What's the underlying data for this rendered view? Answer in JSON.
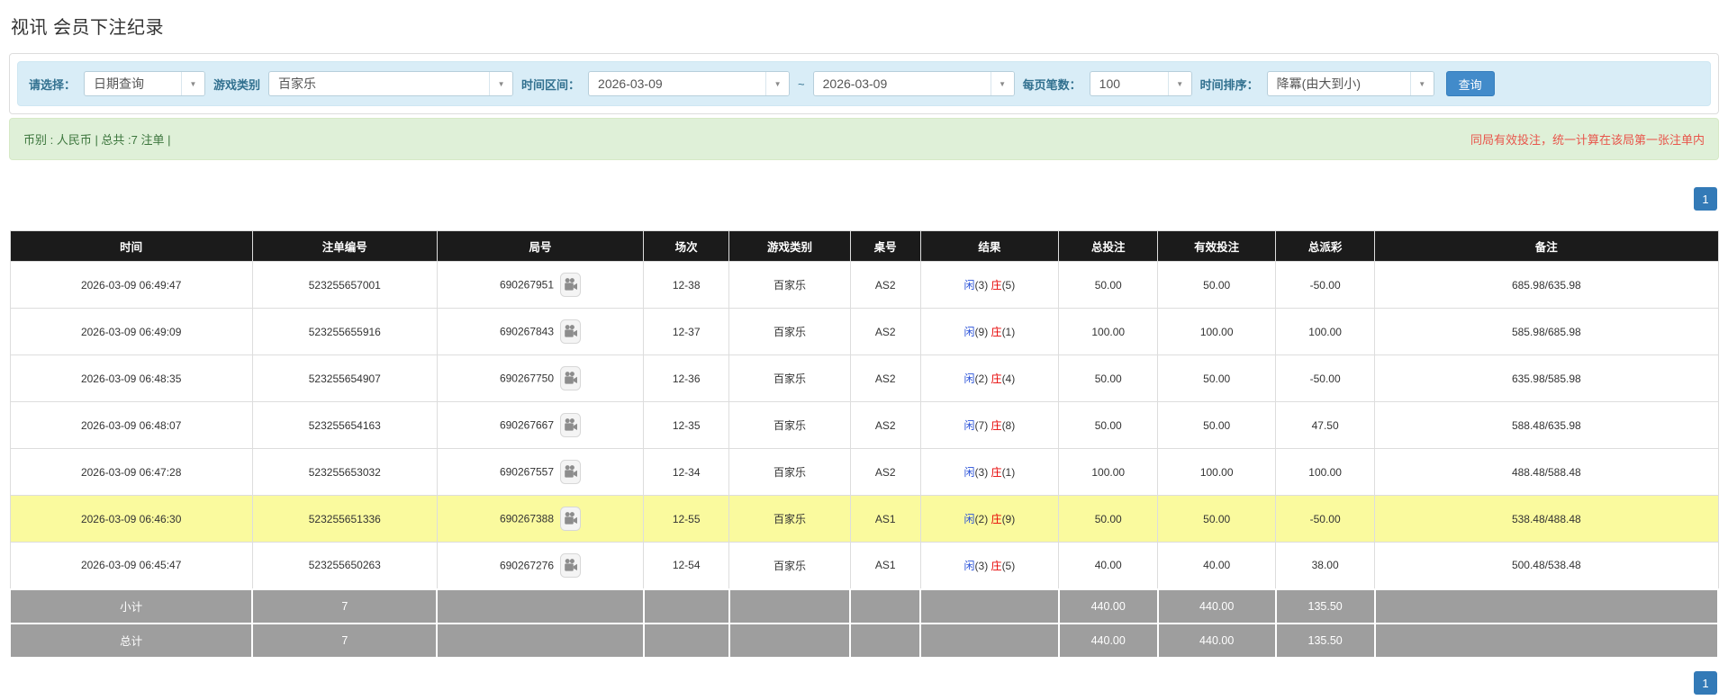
{
  "page_title": "视讯 会员下注纪录",
  "filters": {
    "query_type": {
      "label": "请选择：",
      "value": "日期查询"
    },
    "game_type": {
      "label": "游戏类别",
      "value": "百家乐"
    },
    "date_range": {
      "label": "时间区间：",
      "from": "2026-03-09",
      "separator": "~",
      "to": "2026-03-09"
    },
    "page_size": {
      "label": "每页笔数：",
      "value": "100"
    },
    "sort_order": {
      "label": "时间排序：",
      "value": "降冪(由大到小)"
    },
    "search_button": "查询"
  },
  "summary": {
    "currency_info": "币别 : 人民币 | 总共 :7 注单 |",
    "notice": "同局有效投注，统一计算在该局第一张注单内"
  },
  "pagination": {
    "current_page": "1"
  },
  "table": {
    "headers": [
      "时间",
      "注单编号",
      "局号",
      "场次",
      "游戏类别",
      "桌号",
      "结果",
      "总投注",
      "有效投注",
      "总派彩",
      "备注"
    ],
    "result_labels": {
      "player": "闲",
      "banker": "庄"
    },
    "rows": [
      {
        "time": "2026-03-09 06:49:47",
        "bet_no": "523255657001",
        "round_no": "690267951",
        "session": "12-38",
        "game": "百家乐",
        "table_no": "AS2",
        "player_score": "3",
        "banker_score": "5",
        "total_bet": "50.00",
        "valid_bet": "50.00",
        "payout": "-50.00",
        "note": "685.98/635.98",
        "highlight": false
      },
      {
        "time": "2026-03-09 06:49:09",
        "bet_no": "523255655916",
        "round_no": "690267843",
        "session": "12-37",
        "game": "百家乐",
        "table_no": "AS2",
        "player_score": "9",
        "banker_score": "1",
        "total_bet": "100.00",
        "valid_bet": "100.00",
        "payout": "100.00",
        "note": "585.98/685.98",
        "highlight": false
      },
      {
        "time": "2026-03-09 06:48:35",
        "bet_no": "523255654907",
        "round_no": "690267750",
        "session": "12-36",
        "game": "百家乐",
        "table_no": "AS2",
        "player_score": "2",
        "banker_score": "4",
        "total_bet": "50.00",
        "valid_bet": "50.00",
        "payout": "-50.00",
        "note": "635.98/585.98",
        "highlight": false
      },
      {
        "time": "2026-03-09 06:48:07",
        "bet_no": "523255654163",
        "round_no": "690267667",
        "session": "12-35",
        "game": "百家乐",
        "table_no": "AS2",
        "player_score": "7",
        "banker_score": "8",
        "total_bet": "50.00",
        "valid_bet": "50.00",
        "payout": "47.50",
        "note": "588.48/635.98",
        "highlight": false
      },
      {
        "time": "2026-03-09 06:47:28",
        "bet_no": "523255653032",
        "round_no": "690267557",
        "session": "12-34",
        "game": "百家乐",
        "table_no": "AS2",
        "player_score": "3",
        "banker_score": "1",
        "total_bet": "100.00",
        "valid_bet": "100.00",
        "payout": "100.00",
        "note": "488.48/588.48",
        "highlight": false
      },
      {
        "time": "2026-03-09 06:46:30",
        "bet_no": "523255651336",
        "round_no": "690267388",
        "session": "12-55",
        "game": "百家乐",
        "table_no": "AS1",
        "player_score": "2",
        "banker_score": "9",
        "total_bet": "50.00",
        "valid_bet": "50.00",
        "payout": "-50.00",
        "note": "538.48/488.48",
        "highlight": true
      },
      {
        "time": "2026-03-09 06:45:47",
        "bet_no": "523255650263",
        "round_no": "690267276",
        "session": "12-54",
        "game": "百家乐",
        "table_no": "AS1",
        "player_score": "3",
        "banker_score": "5",
        "total_bet": "40.00",
        "valid_bet": "40.00",
        "payout": "38.00",
        "note": "500.48/538.48",
        "highlight": false
      }
    ],
    "subtotal": {
      "label": "小计",
      "count": "7",
      "total_bet": "440.00",
      "valid_bet": "440.00",
      "payout": "135.50"
    },
    "grand_total": {
      "label": "总计",
      "count": "7",
      "total_bet": "440.00",
      "valid_bet": "440.00",
      "payout": "135.50"
    }
  },
  "icons": {
    "dropdown_arrow": "▼",
    "video_replay": "video-replay"
  },
  "colors": {
    "accent_blue": "#428bca",
    "link_blue": "#3d8bd5",
    "player_blue": "#2a52d8",
    "banker_red": "#e60000",
    "negative_red": "#e60000",
    "notice_red": "#e8554b",
    "filter_bg": "#d9edf7",
    "filter_label": "#31708f",
    "summary_bg": "#dff0d8",
    "summary_text": "#3c763d",
    "table_header_bg": "#1b1b1b",
    "highlight_yellow": "#fafa9e",
    "totals_gray": "#9e9e9e"
  }
}
